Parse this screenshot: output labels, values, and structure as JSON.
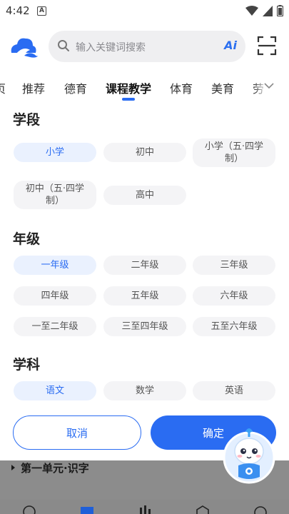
{
  "status_bar": {
    "time": "4:42",
    "notification_letter": "A"
  },
  "header": {
    "search_placeholder": "输入关键词搜索",
    "ai_label": "Ai"
  },
  "tabs": [
    {
      "label": "页"
    },
    {
      "label": "推荐"
    },
    {
      "label": "德育"
    },
    {
      "label": "课程教学",
      "active": true
    },
    {
      "label": "体育"
    },
    {
      "label": "美育"
    },
    {
      "label": "劳"
    }
  ],
  "filters": {
    "stage": {
      "title": "学段",
      "options": [
        "小学",
        "初中",
        "小学（五·四学制）",
        "初中（五·四学制）",
        "高中"
      ],
      "selected": "小学"
    },
    "grade": {
      "title": "年级",
      "options": [
        "一年级",
        "二年级",
        "三年级",
        "四年级",
        "五年级",
        "六年级",
        "一至二年级",
        "三至四年级",
        "五至六年级"
      ],
      "selected": "一年级"
    },
    "subject": {
      "title": "学科",
      "options": [
        "语文",
        "数学",
        "英语"
      ],
      "selected": "语文"
    }
  },
  "actions": {
    "cancel": "取消",
    "confirm": "确定"
  },
  "background": {
    "unit_title": "第一单元·识字"
  },
  "colors": {
    "accent": "#2a6cf2",
    "chip_bg": "#f4f4f6",
    "chip_selected_bg": "#eaf1fe"
  }
}
